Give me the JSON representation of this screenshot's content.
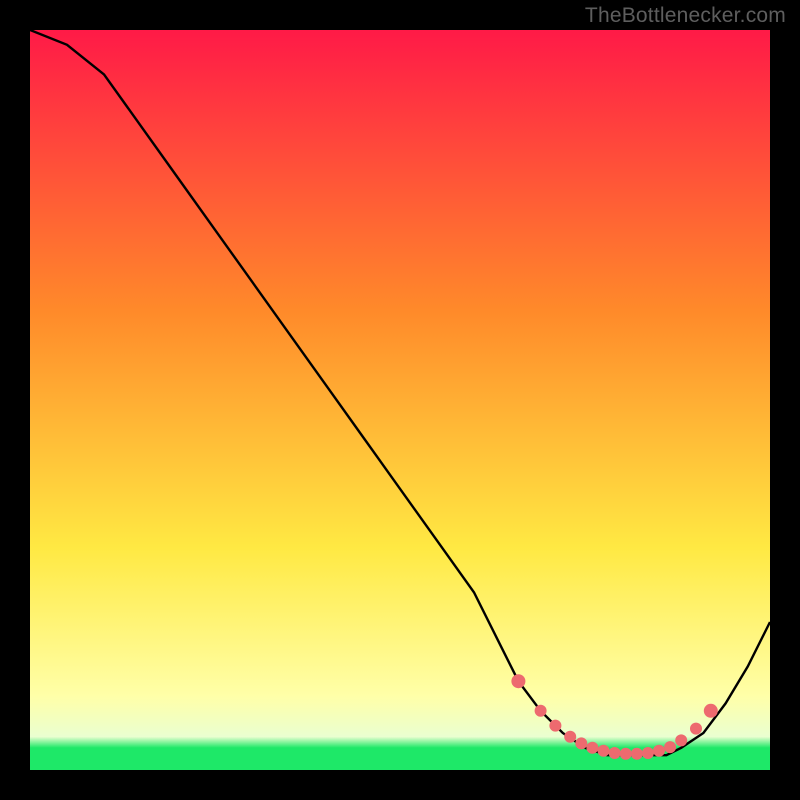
{
  "watermark": "TheBottlenecker.com",
  "colors": {
    "bg": "#000000",
    "curve": "#000000",
    "marker": "#ed6a6f",
    "grad_top": "#ff1a47",
    "grad_mid1": "#ff8a2a",
    "grad_mid2": "#ffe943",
    "grad_pale": "#ffffa8",
    "grad_green": "#1ee868"
  },
  "chart_data": {
    "type": "line",
    "title": "",
    "xlabel": "",
    "ylabel": "",
    "xlim": [
      0,
      100
    ],
    "ylim": [
      0,
      100
    ],
    "series": [
      {
        "name": "bottleneck-curve",
        "x": [
          0,
          5,
          10,
          15,
          20,
          25,
          30,
          35,
          40,
          45,
          50,
          55,
          60,
          63,
          66,
          69,
          72,
          75,
          78,
          81,
          84,
          86,
          88,
          91,
          94,
          97,
          100
        ],
        "y": [
          100,
          98,
          94,
          87,
          80,
          73,
          66,
          59,
          52,
          45,
          38,
          31,
          24,
          18,
          12,
          8,
          5,
          3,
          2,
          2,
          2,
          2,
          3,
          5,
          9,
          14,
          20
        ]
      }
    ],
    "markers": {
      "name": "optimal-range",
      "x": [
        66,
        69,
        71,
        73,
        74.5,
        76,
        77.5,
        79,
        80.5,
        82,
        83.5,
        85,
        86.5,
        88,
        90,
        92
      ],
      "y": [
        12,
        8,
        6,
        4.5,
        3.6,
        3.0,
        2.6,
        2.3,
        2.2,
        2.2,
        2.3,
        2.6,
        3.1,
        4.0,
        5.6,
        8.0
      ]
    }
  }
}
